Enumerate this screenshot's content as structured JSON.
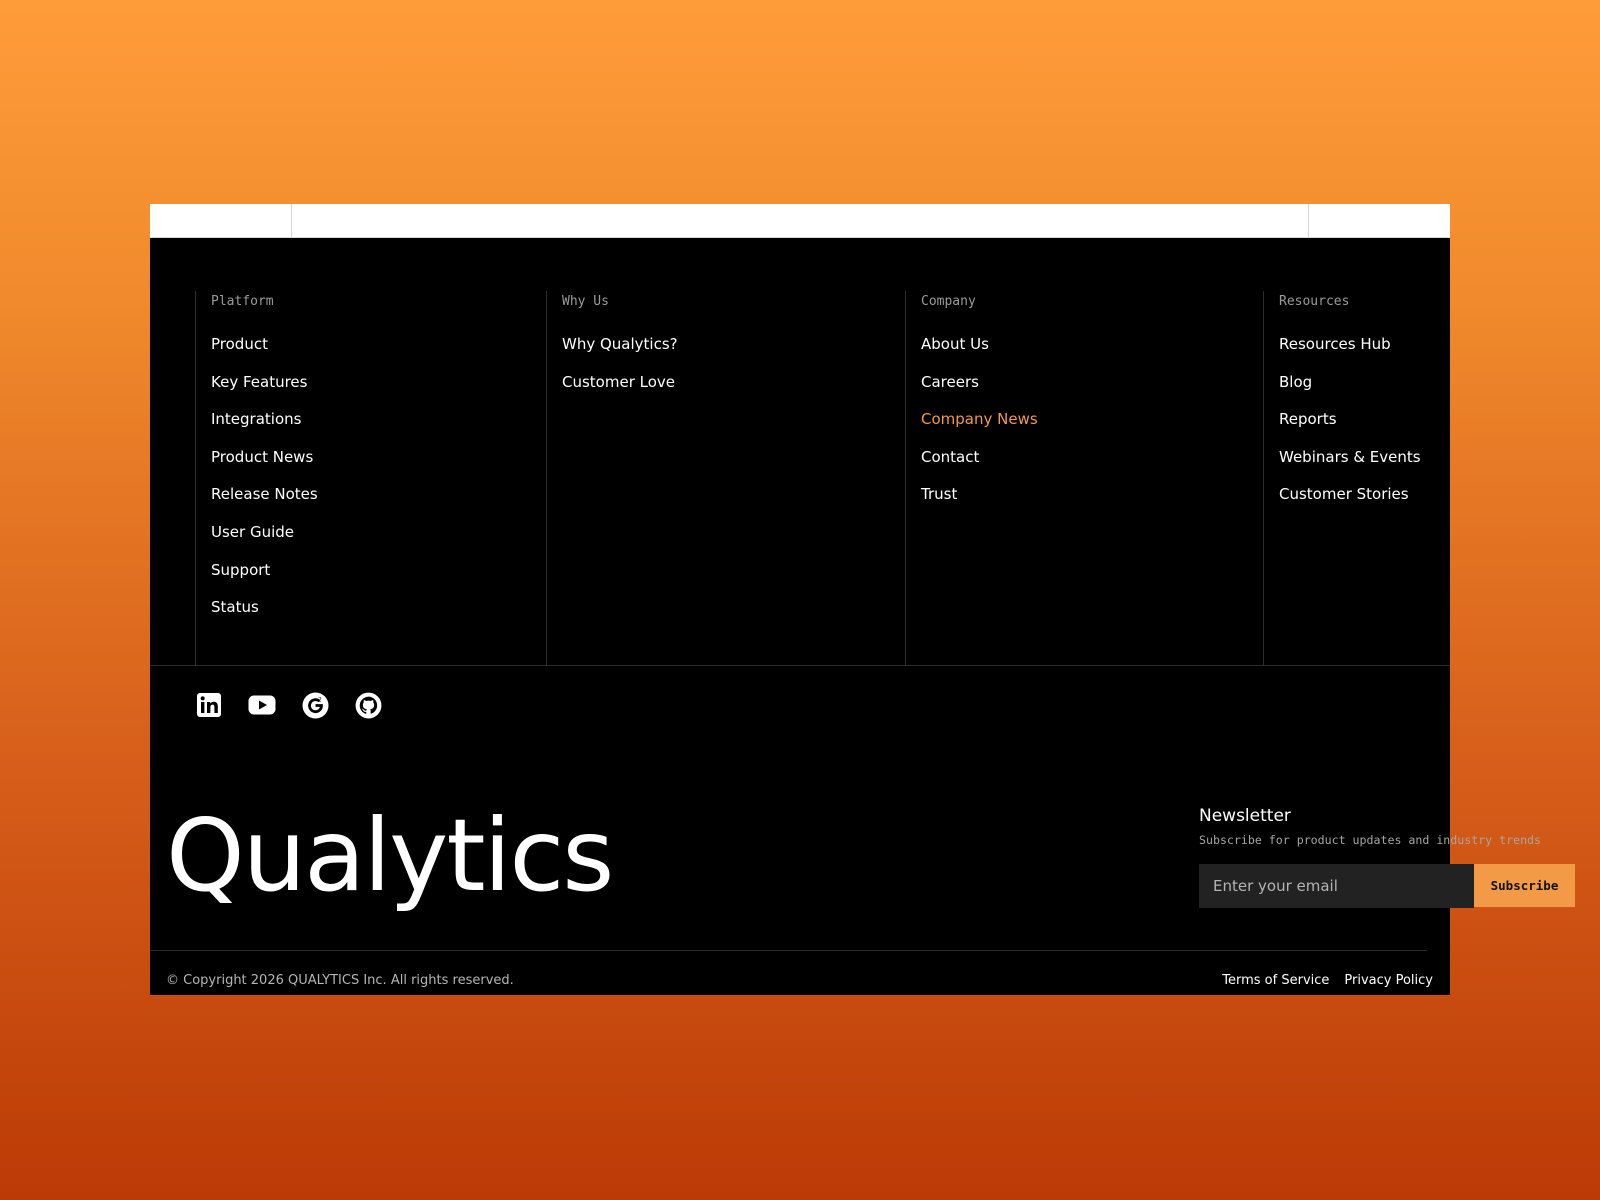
{
  "footer": {
    "columns": [
      {
        "heading": "Platform",
        "items": [
          "Product",
          "Key Features",
          "Integrations",
          "Product News",
          "Release Notes",
          "User Guide",
          "Support",
          "Status"
        ]
      },
      {
        "heading": "Why Us",
        "items": [
          "Why Qualytics?",
          "Customer Love"
        ]
      },
      {
        "heading": "Company",
        "items": [
          "About Us",
          "Careers",
          "Company News",
          "Contact",
          "Trust"
        ],
        "active_item": "Company News"
      },
      {
        "heading": "Resources",
        "items": [
          "Resources Hub",
          "Blog",
          "Reports",
          "Webinars & Events",
          "Customer Stories"
        ]
      }
    ],
    "socials": [
      "linkedin-icon",
      "youtube-icon",
      "g2-icon",
      "github-icon"
    ],
    "logo_text": "Qualytics",
    "newsletter": {
      "title": "Newsletter",
      "subtitle": "Subscribe for product updates and industry trends",
      "email_placeholder": "Enter your email",
      "button_label": "Subscribe"
    },
    "copyright": "© Copyright 2026 QUALYTICS Inc. All rights reserved.",
    "legal_links": [
      "Terms of Service",
      "Privacy Policy"
    ]
  },
  "colors": {
    "accent": "#f29a46",
    "footer_bg": "#000000",
    "input_bg": "#222222"
  }
}
